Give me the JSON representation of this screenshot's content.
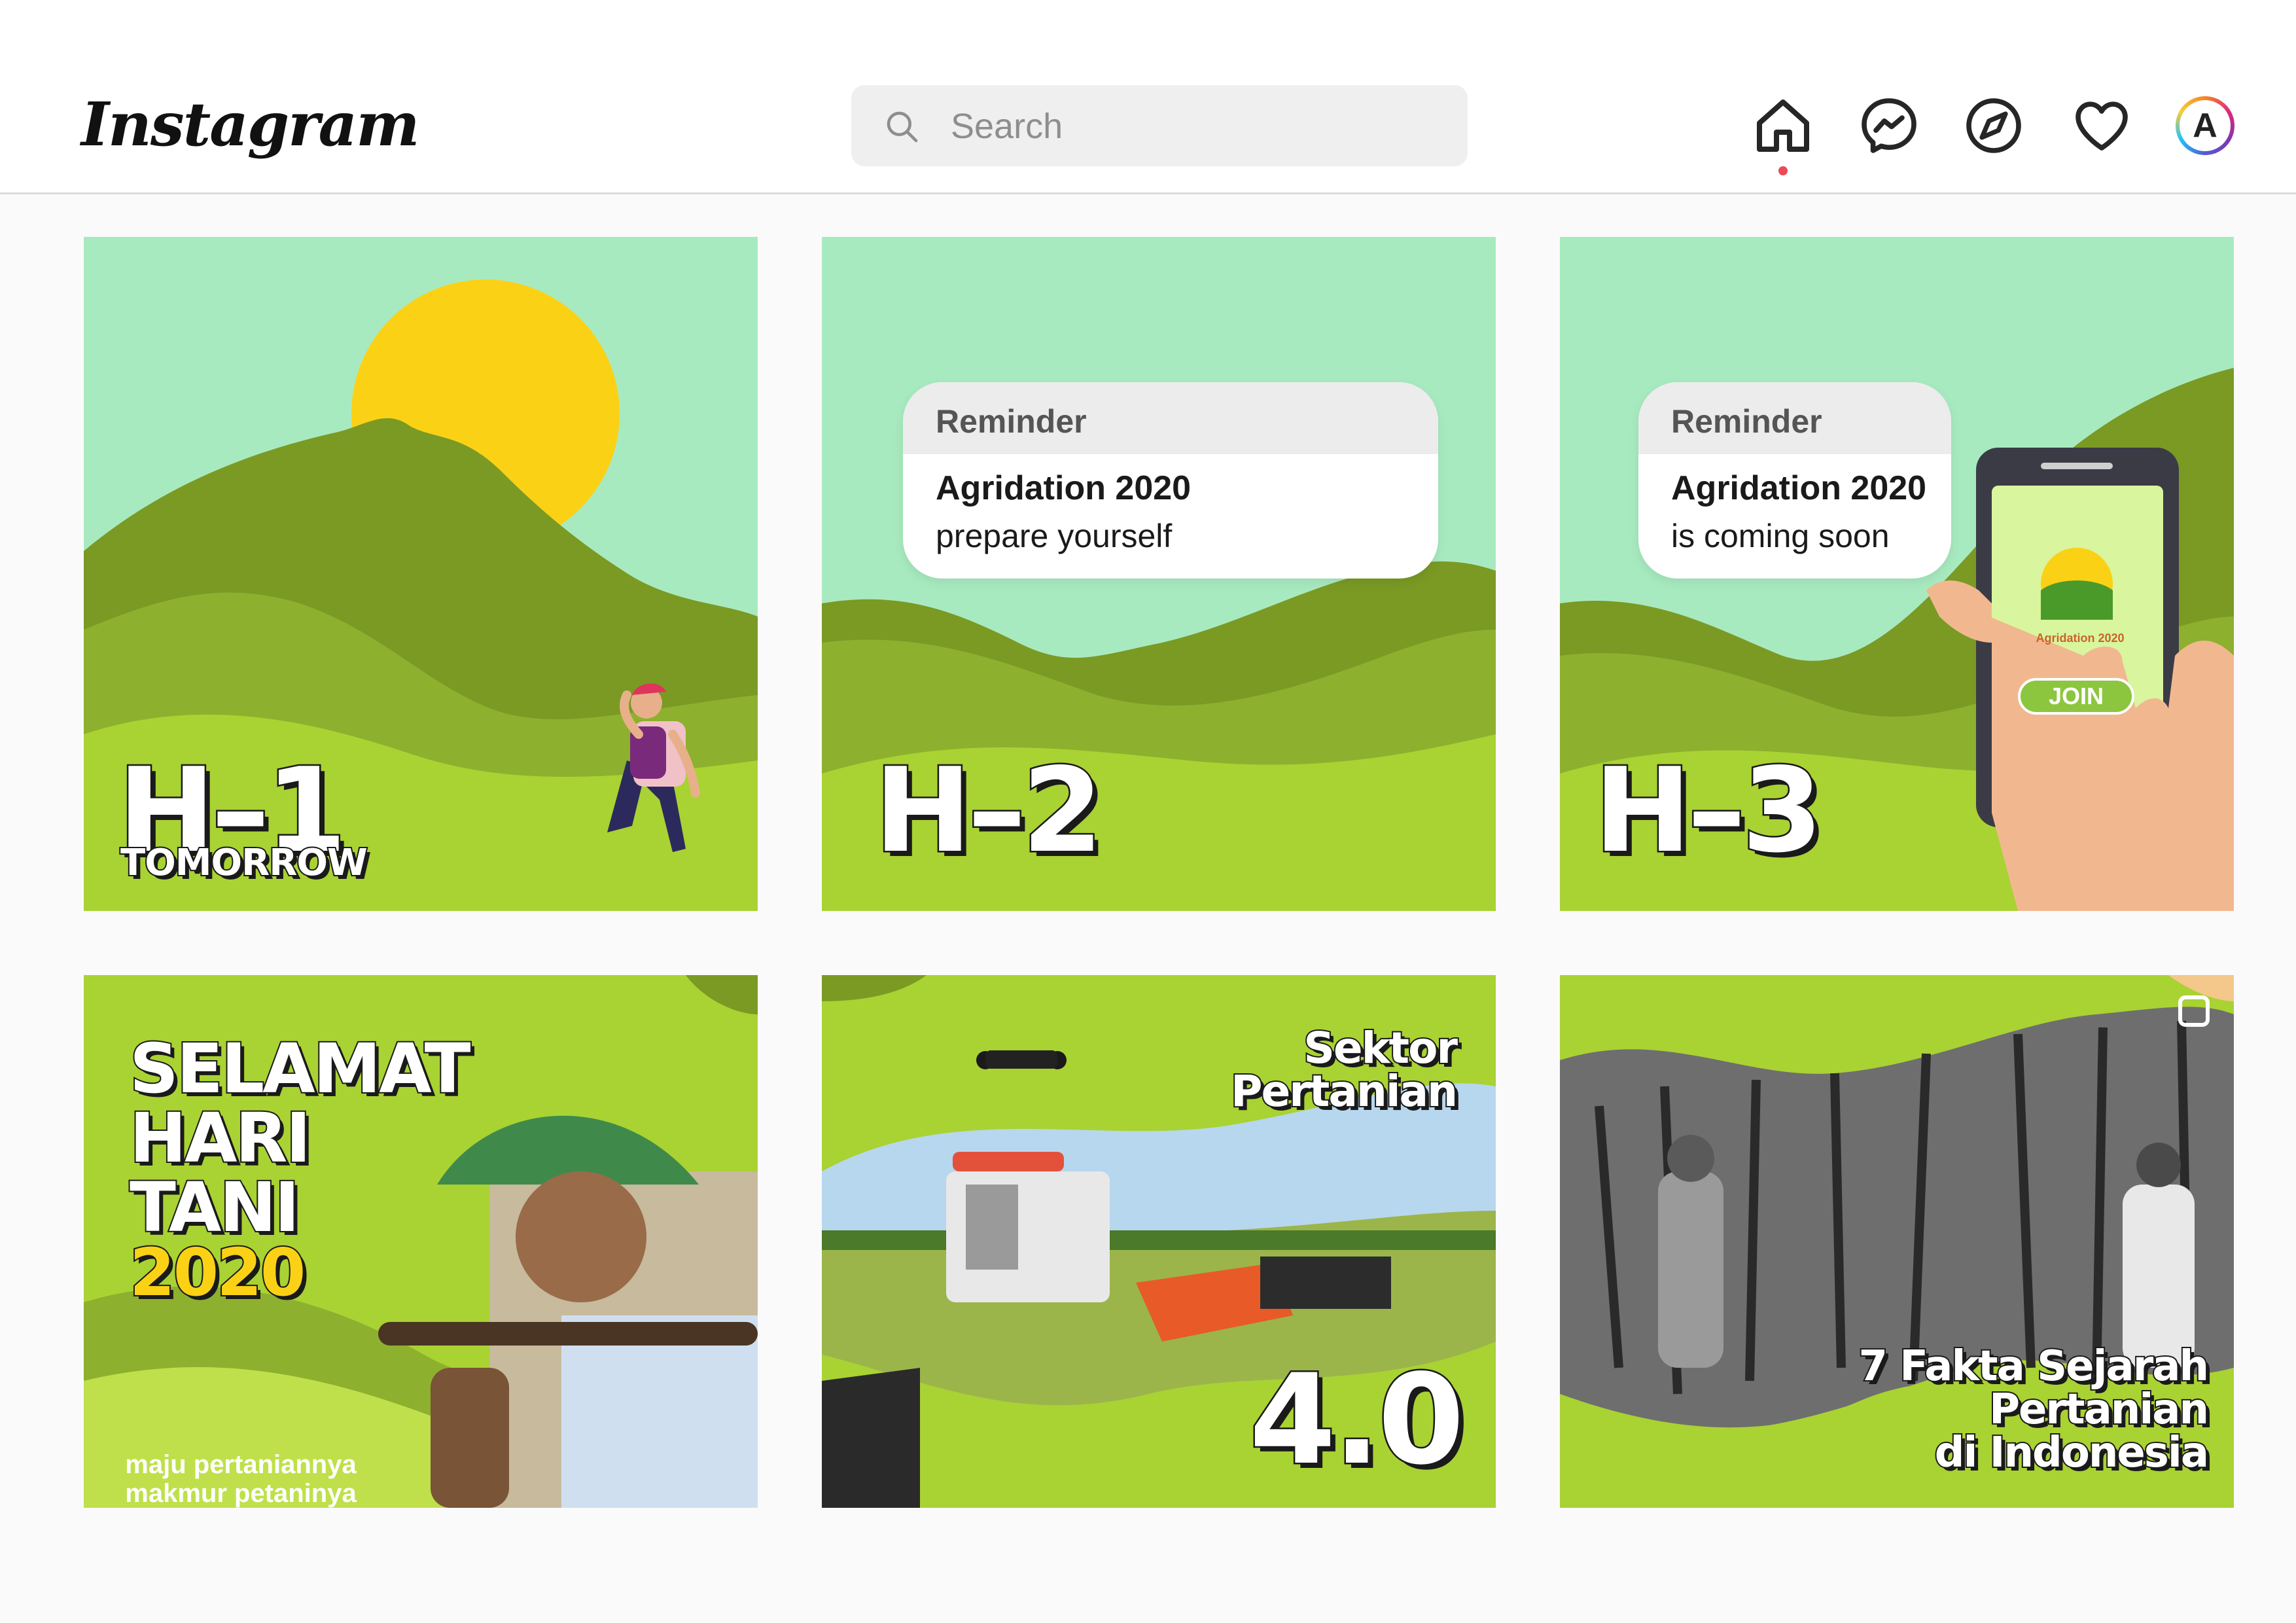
{
  "header": {
    "logo": "Instagram",
    "search": {
      "placeholder": "Search"
    },
    "nav": [
      {
        "icon": "home-icon",
        "active": true
      },
      {
        "icon": "messenger-icon"
      },
      {
        "icon": "explore-compass-icon"
      },
      {
        "icon": "heart-icon"
      },
      {
        "icon": "profile-avatar",
        "initial": "A"
      }
    ]
  },
  "colors": {
    "sky": "#a8eac0",
    "hill_dark": "#7a9a24",
    "hill_mid": "#8db02e",
    "hill_light": "#a9d233",
    "sun": "#fbd116",
    "accent_red": "#ed4956"
  },
  "posts": [
    {
      "big": "H–1",
      "sub": "TOMORROW"
    },
    {
      "big": "H–2",
      "reminder": {
        "label": "Reminder",
        "title": "Agridation 2020",
        "text": "prepare yourself"
      }
    },
    {
      "big": "H–3",
      "reminder": {
        "label": "Reminder",
        "title": "Agridation 2020",
        "text": "is coming soon"
      },
      "phone": {
        "app": "Agridation 2020",
        "button": "JOIN"
      }
    },
    {
      "lines": [
        "SELAMAT",
        "HARI",
        "TANI",
        "2020"
      ],
      "caption": [
        "maju pertaniannya",
        "makmur petaninya"
      ]
    },
    {
      "title": [
        "Sektor",
        "Pertanian"
      ],
      "big": "4.0"
    },
    {
      "title": [
        "7 Fakta Sejarah",
        "Pertanian",
        "di Indonesia"
      ]
    }
  ]
}
